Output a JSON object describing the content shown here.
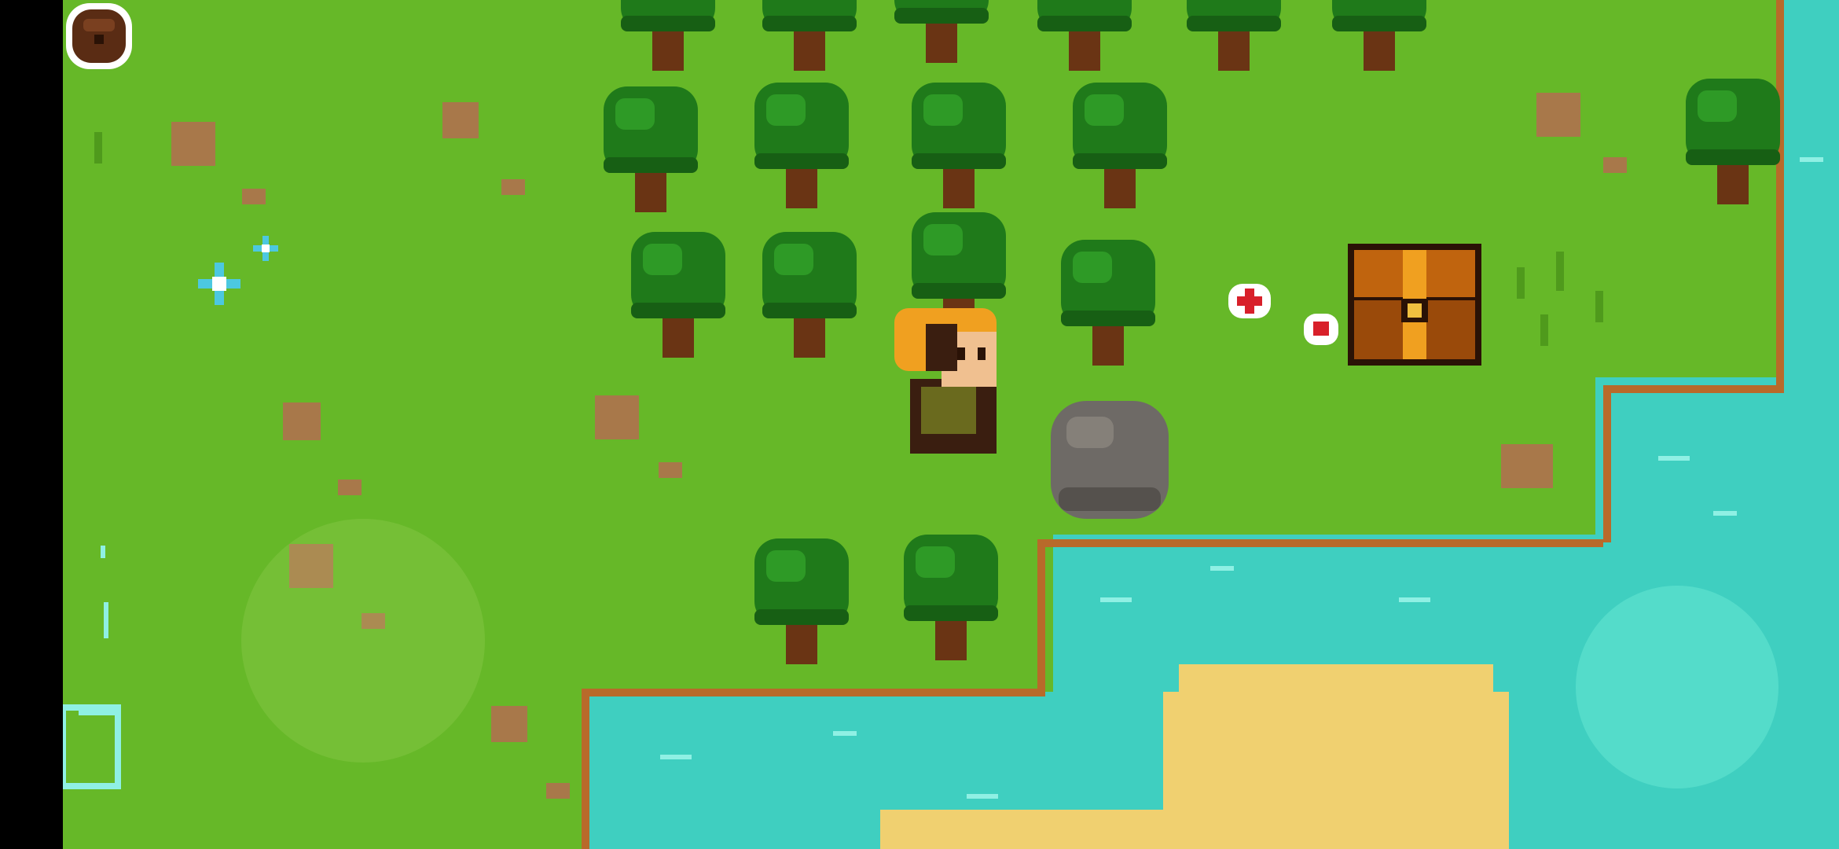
{
  "scene": {
    "type": "top-down pixel-art overworld",
    "colors": {
      "grass": "#66b828",
      "grass_dark": "#4f9a1c",
      "water": "#3fcfc0",
      "water_light": "#8ff0e4",
      "sand": "#f0d070",
      "dirt_edge": "#b86a2a",
      "tree_leaf": "#1f7a1a",
      "tree_trunk": "#6a3414",
      "rock": "#6e6a66",
      "chest": "#b85a10"
    }
  },
  "player": {
    "name_icon": "player-character-icon",
    "hair_color": "#f0a020"
  },
  "objects": {
    "chest_icon": "treasure-chest-icon",
    "rock_icon": "boulder-icon",
    "flower_icon": "red-flower-icon",
    "blue_flower_icon": "blue-flower-icon"
  },
  "hud": {
    "bag_icon": "backpack-icon",
    "left_joystick_icon": "movement-joystick",
    "right_joystick_icon": "action-joystick"
  }
}
